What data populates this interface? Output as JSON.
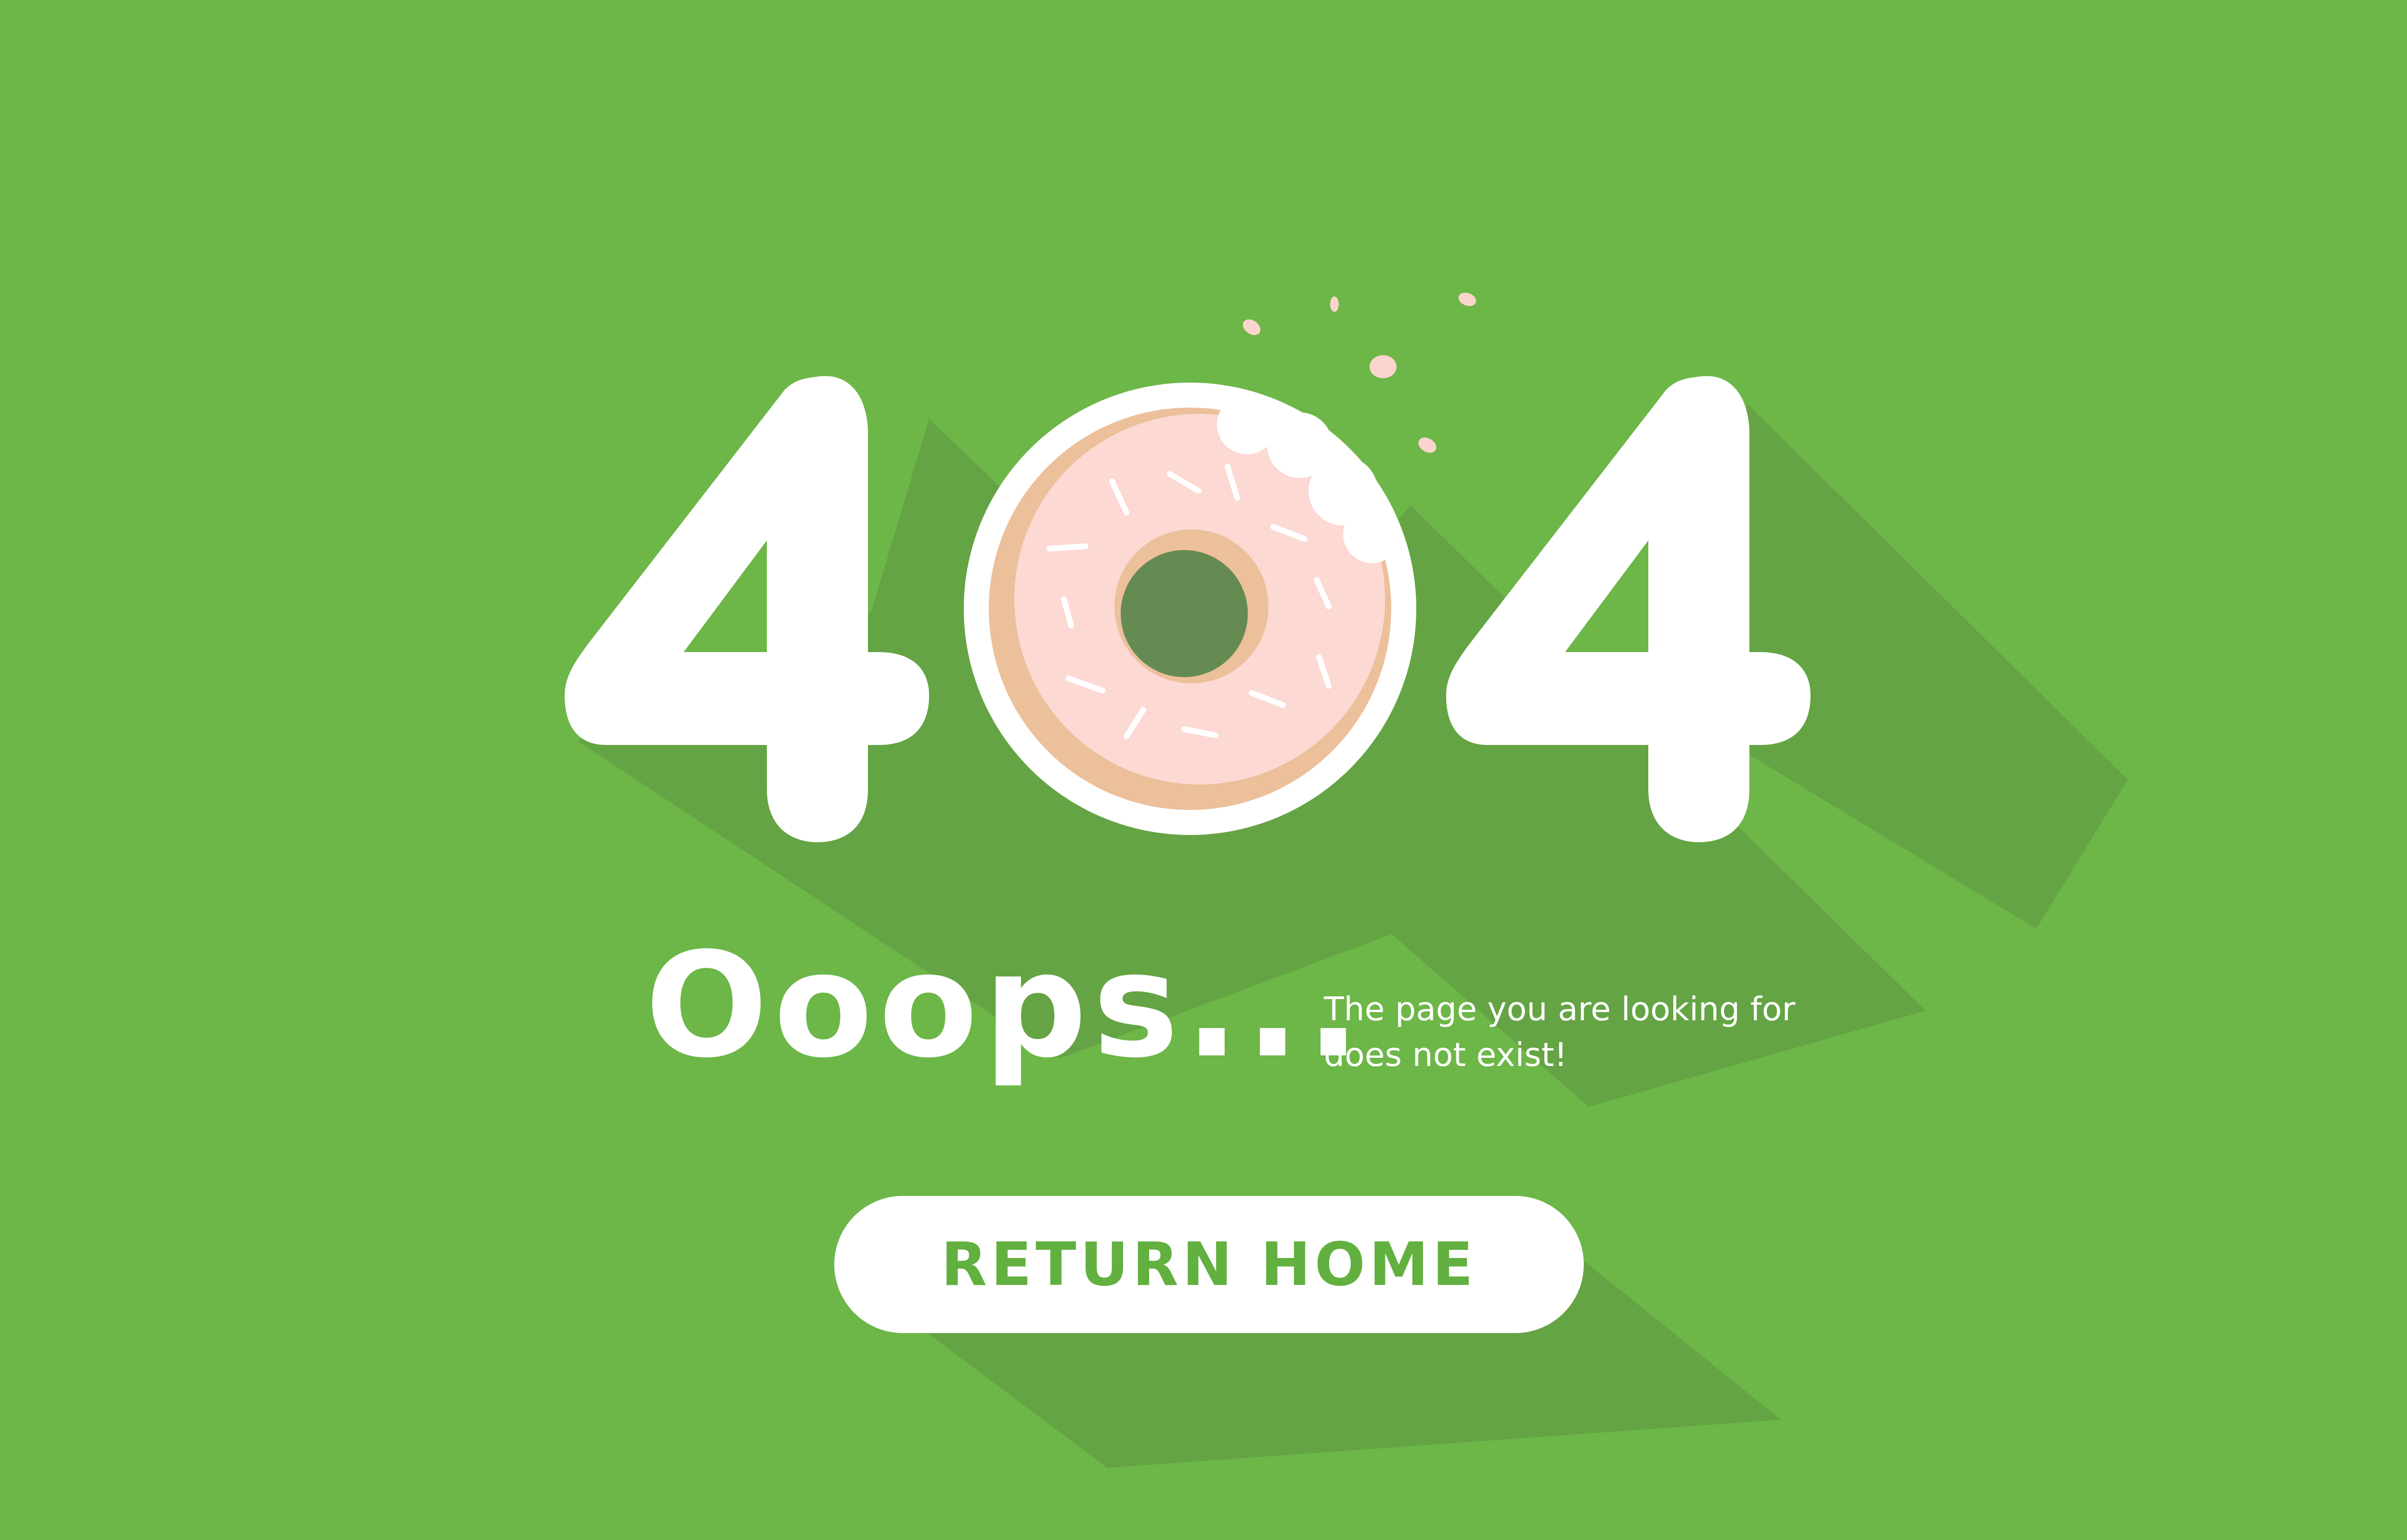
{
  "error_code": {
    "digit_left": "4",
    "digit_right": "4",
    "center_icon": "bitten-donut-icon"
  },
  "headline": "Ooops...",
  "message": {
    "line1": "The page you are looking for",
    "line2": "does not exist!"
  },
  "return_button": {
    "label": "RETURN HOME"
  },
  "colors": {
    "background": "#6db648",
    "shadow": "#64a444",
    "text": "#ffffff",
    "button_text": "#62b040",
    "donut_dough": "#ecc09b",
    "donut_frosting": "#fcd9d3",
    "crumbs": "#fbd5cd"
  }
}
